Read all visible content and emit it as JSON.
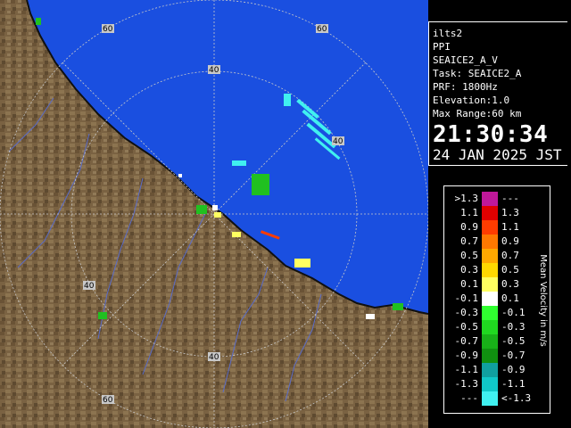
{
  "radar": {
    "range_ring_labels": [
      "60",
      "60",
      "40",
      "40",
      "40",
      "40",
      "60"
    ],
    "colors": {
      "sea": "#1a4fe0",
      "land": "#7a6242",
      "grid": "#c8c8c8",
      "coast": "#101010",
      "river": "#5a6cc8"
    }
  },
  "info": {
    "site": "ilts2",
    "mode": "PPI",
    "product": "SEAICE2_A_V",
    "task": "Task: SEAICE2_A",
    "prf": "PRF: 1800Hz",
    "elevation": "Elevation:1.0",
    "max_range": "Max Range:60 km",
    "time": "21:30:34",
    "date": "24 JAN 2025 JST"
  },
  "legend": {
    "unit": "Mean Velocity in m/s",
    "rows": [
      {
        "lo": ">1.3",
        "hi": "---",
        "color": "#c0189a"
      },
      {
        "lo": "1.1",
        "hi": "1.3",
        "color": "#e00000"
      },
      {
        "lo": "0.9",
        "hi": "1.1",
        "color": "#ff3c00"
      },
      {
        "lo": "0.7",
        "hi": "0.9",
        "color": "#ff7800"
      },
      {
        "lo": "0.5",
        "hi": "0.7",
        "color": "#ffa800"
      },
      {
        "lo": "0.3",
        "hi": "0.5",
        "color": "#ffd800"
      },
      {
        "lo": "0.1",
        "hi": "0.3",
        "color": "#ffff60"
      },
      {
        "lo": "-0.1",
        "hi": "0.1",
        "color": "#ffffff"
      },
      {
        "lo": "-0.3",
        "hi": "-0.1",
        "color": "#30ff30"
      },
      {
        "lo": "-0.5",
        "hi": "-0.3",
        "color": "#20d820"
      },
      {
        "lo": "-0.7",
        "hi": "-0.5",
        "color": "#18b018"
      },
      {
        "lo": "-0.9",
        "hi": "-0.7",
        "color": "#109010"
      },
      {
        "lo": "-1.1",
        "hi": "-0.9",
        "color": "#10a0a0"
      },
      {
        "lo": "-1.3",
        "hi": "-1.1",
        "color": "#10c8c8"
      },
      {
        "lo": "---",
        "hi": "<-1.3",
        "color": "#40f0f0"
      }
    ]
  }
}
